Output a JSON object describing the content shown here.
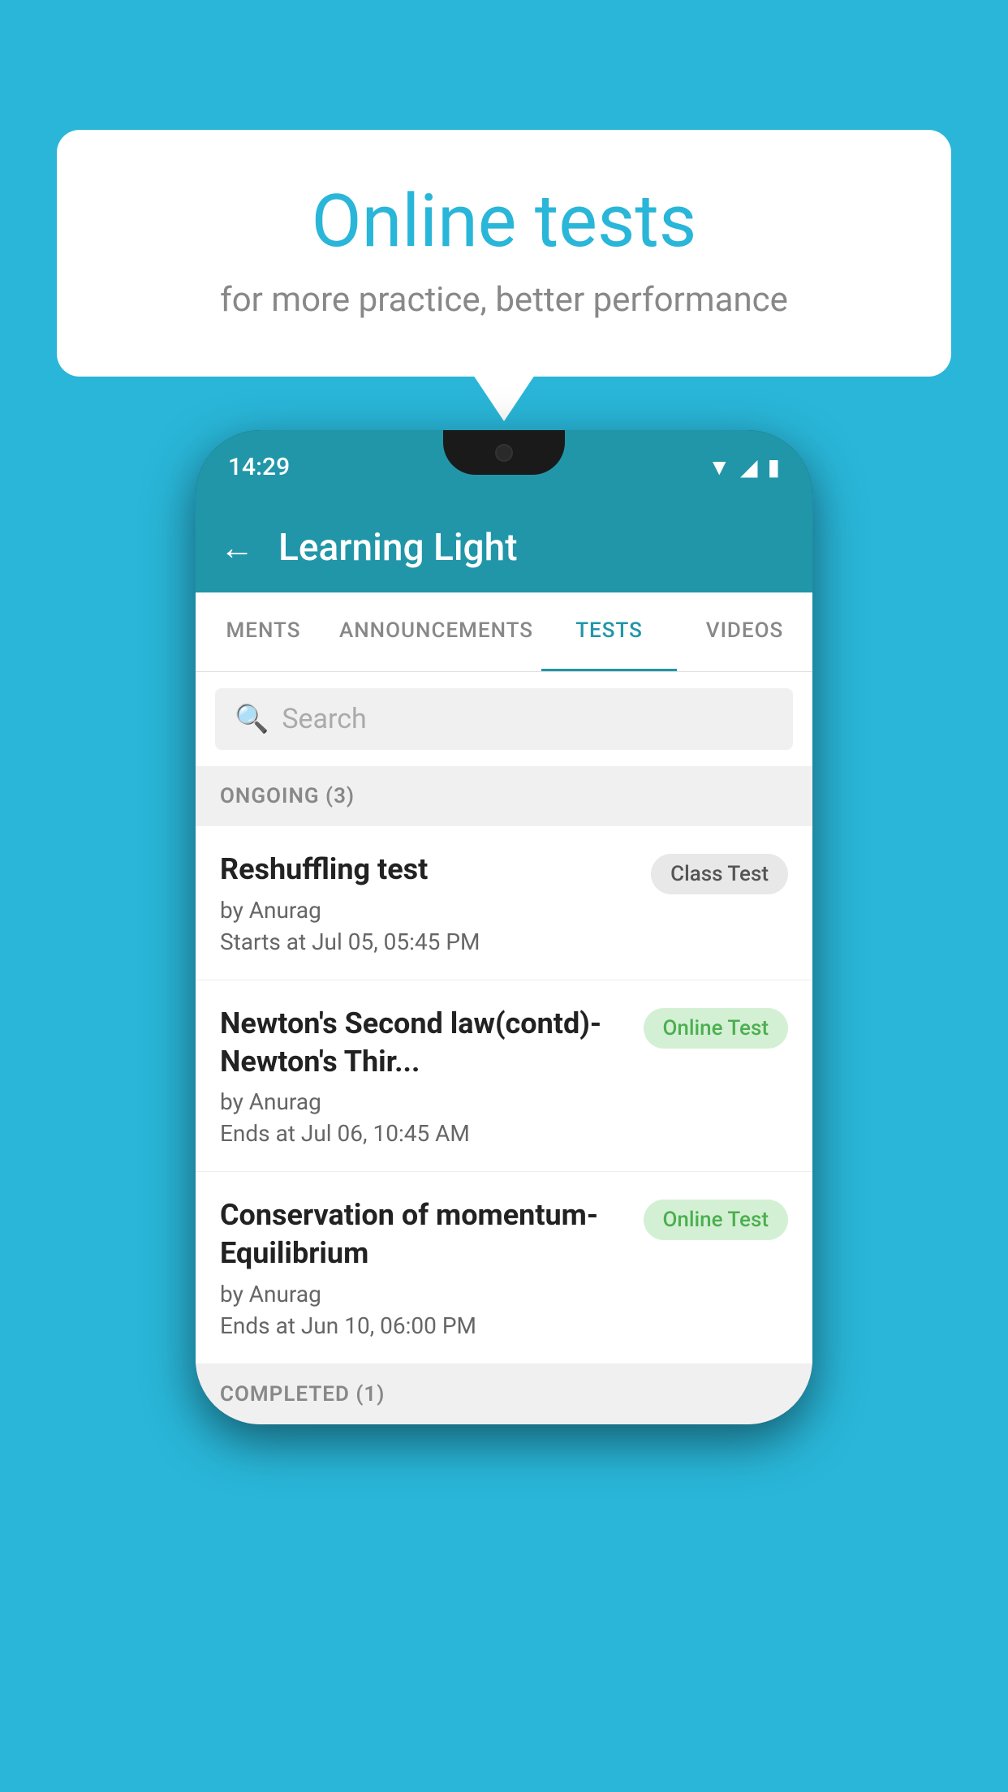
{
  "background_color": "#29b6d8",
  "speech_bubble": {
    "title": "Online tests",
    "subtitle": "for more practice, better performance"
  },
  "phone": {
    "status_bar": {
      "time": "14:29"
    },
    "app_header": {
      "title": "Learning Light",
      "back_label": "←"
    },
    "tabs": [
      {
        "label": "MENTS",
        "active": false
      },
      {
        "label": "ANNOUNCEMENTS",
        "active": false
      },
      {
        "label": "TESTS",
        "active": true
      },
      {
        "label": "VIDEOS",
        "active": false
      }
    ],
    "search": {
      "placeholder": "Search"
    },
    "ongoing_section": {
      "title": "ONGOING (3)"
    },
    "tests": [
      {
        "name": "Reshuffling test",
        "author": "by Anurag",
        "time_label": "Starts at",
        "time": "Jul 05, 05:45 PM",
        "badge": "Class Test",
        "badge_type": "class"
      },
      {
        "name": "Newton's Second law(contd)-Newton's Thir...",
        "author": "by Anurag",
        "time_label": "Ends at",
        "time": "Jul 06, 10:45 AM",
        "badge": "Online Test",
        "badge_type": "online"
      },
      {
        "name": "Conservation of momentum-Equilibrium",
        "author": "by Anurag",
        "time_label": "Ends at",
        "time": "Jun 10, 06:00 PM",
        "badge": "Online Test",
        "badge_type": "online"
      }
    ],
    "completed_section": {
      "title": "COMPLETED (1)"
    }
  }
}
